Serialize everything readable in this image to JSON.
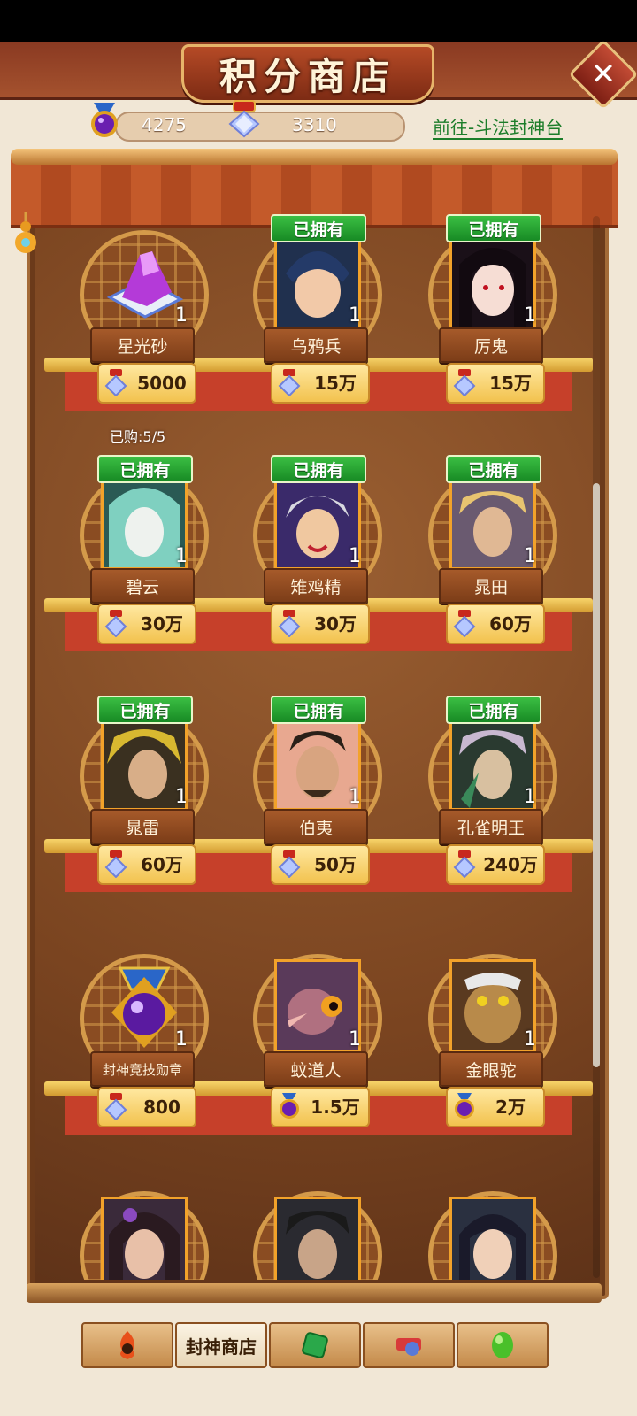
{
  "title": "积分商店",
  "currencies": [
    {
      "icon": "purple-orb-medal-icon",
      "value": "4275"
    },
    {
      "icon": "crystal-pouch-icon",
      "value": "3310"
    }
  ],
  "goto_link": "前往-斗法封神台",
  "owned_label": "已拥有",
  "purchased_note": "已购:5/5",
  "items": [
    {
      "name": "星光砂",
      "price": "5000",
      "qty": "1",
      "owned": false,
      "currency": "crystal"
    },
    {
      "name": "乌鸦兵",
      "price": "15万",
      "qty": "1",
      "owned": true,
      "currency": "crystal"
    },
    {
      "name": "厉鬼",
      "price": "15万",
      "qty": "1",
      "owned": true,
      "currency": "crystal"
    },
    {
      "name": "碧云",
      "price": "30万",
      "qty": "1",
      "owned": true,
      "currency": "crystal"
    },
    {
      "name": "雉鸡精",
      "price": "30万",
      "qty": "1",
      "owned": true,
      "currency": "crystal"
    },
    {
      "name": "晁田",
      "price": "60万",
      "qty": "1",
      "owned": true,
      "currency": "crystal"
    },
    {
      "name": "晁雷",
      "price": "60万",
      "qty": "1",
      "owned": true,
      "currency": "crystal"
    },
    {
      "name": "伯夷",
      "price": "50万",
      "qty": "1",
      "owned": true,
      "currency": "crystal"
    },
    {
      "name": "孔雀明王",
      "price": "240万",
      "qty": "1",
      "owned": true,
      "currency": "crystal"
    },
    {
      "name": "封神竞技勋章",
      "price": "800",
      "qty": "1",
      "owned": false,
      "currency": "crystal"
    },
    {
      "name": "蚊道人",
      "price": "1.5万",
      "qty": "1",
      "owned": false,
      "currency": "purple-orb"
    },
    {
      "name": "金眼驼",
      "price": "2万",
      "qty": "1",
      "owned": false,
      "currency": "purple-orb"
    }
  ],
  "tabs": [
    {
      "icon": "flame-emblem-icon",
      "label": ""
    },
    {
      "icon": "",
      "label": "封神商店"
    },
    {
      "icon": "green-jade-icon",
      "label": ""
    },
    {
      "icon": "scroll-seal-icon",
      "label": ""
    },
    {
      "icon": "green-bean-icon",
      "label": ""
    }
  ],
  "colors": {
    "owned_tag": "#1f9a2c",
    "link": "#1c7d2a",
    "shelf_red": "#c6402a",
    "price_gold": "#f2c24e"
  }
}
